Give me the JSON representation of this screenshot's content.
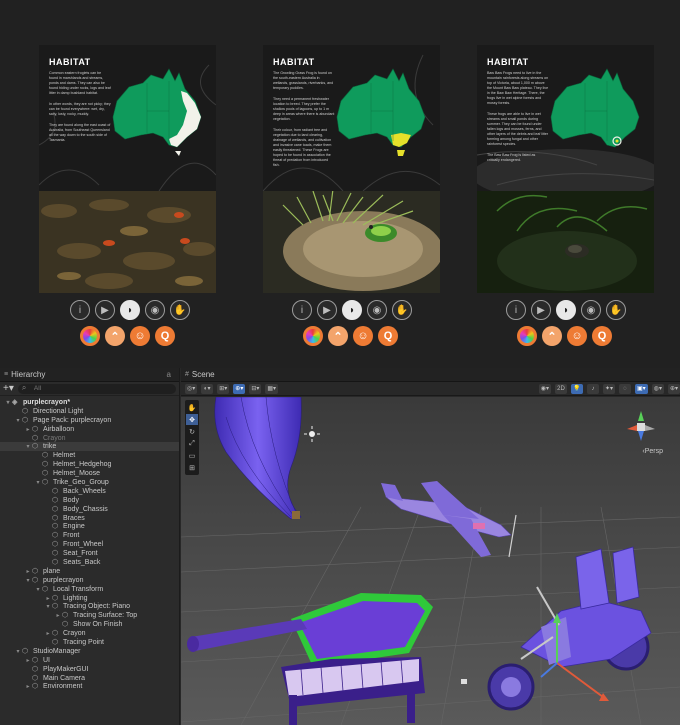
{
  "gallery": {
    "cards": [
      {
        "title": "HABITAT",
        "paragraphs": [
          "Common eastern froglets can be found in marshlands and streams, ponds and dams. They can also be found hiding under rocks, logs and leaf litter in damp bushland habitat.",
          "In other words, they are not picky; they can be found everywhere: wet, dry, salty, lusty, rocky, muddy.",
          "They are found along the east coast of Australia, from Southeast Queensland all the way down to the south side of Tasmania."
        ]
      },
      {
        "title": "HABITAT",
        "paragraphs": [
          "The Growling Grass Frog is found on the south-eastern Australia in wetlands, grasslands, riverbanks, and temporary puddles.",
          "They need a permanent freshwater location to breed. They prefer the shallow pools of lagoons, up to 1 m deep in areas where there is abundant vegetation.",
          "Their colour, from radiant tree and vegetation due to land clearing, drainage of wetlands, and cultivation and invasive cane toads, make them easily threatened. These Frogs are hoped to be found in association the threat of predation from introduced fish."
        ]
      },
      {
        "title": "HABITAT",
        "paragraphs": [
          "Baw Baw Frogs need to live in the mountain rainforests along streams on top of Victoria, about 1,000 m above the Mount Baw Baw plateau. They live in the Baw Baw Heritage. There, the frogs live in wet alpine forests and mossy forests.",
          "These frogs are able to live in wet streams and small ponds during summer. They can be found under fallen logs and mosses, ferns, and other layers of the debris and leaf litter forming among fungal and other rainforest species.",
          "The Baw Baw Frog is listed as critically endangered."
        ]
      }
    ],
    "controls": {
      "row1_icons": [
        "info-icon",
        "video-icon",
        "australia-map-icon",
        "frog-face-icon",
        "hand-icon"
      ],
      "row1_glyphs": [
        "i",
        "▶",
        "◗",
        "◉",
        "✋"
      ],
      "active_index": 2,
      "row2_icons": [
        "color-wheel-icon",
        "chevron-up-icon",
        "face-icon",
        "quiz-icon"
      ],
      "row2_glyphs": [
        "",
        "⌃",
        "☺",
        "Q"
      ]
    }
  },
  "hierarchy": {
    "tab_label": "Hierarchy",
    "tab_lock": "a",
    "search_placeholder": "All",
    "rows": [
      {
        "indent": 0,
        "arrow": "▾",
        "label": "purplecrayon*",
        "root": true
      },
      {
        "indent": 1,
        "arrow": "",
        "label": "Directional Light"
      },
      {
        "indent": 1,
        "arrow": "▾",
        "label": "Page Pack: purplecrayon"
      },
      {
        "indent": 2,
        "arrow": "▸",
        "label": "Airballoon"
      },
      {
        "indent": 2,
        "arrow": "",
        "label": "Crayon",
        "dim": true
      },
      {
        "indent": 2,
        "arrow": "▾",
        "label": "trike",
        "selected": true
      },
      {
        "indent": 3,
        "arrow": "",
        "label": "Helmet"
      },
      {
        "indent": 3,
        "arrow": "",
        "label": "Helmet_Hedgehog"
      },
      {
        "indent": 3,
        "arrow": "",
        "label": "Helmet_Moose"
      },
      {
        "indent": 3,
        "arrow": "▾",
        "label": "Trike_Geo_Group"
      },
      {
        "indent": 4,
        "arrow": "",
        "label": "Back_Wheels"
      },
      {
        "indent": 4,
        "arrow": "",
        "label": "Body"
      },
      {
        "indent": 4,
        "arrow": "",
        "label": "Body_Chassis"
      },
      {
        "indent": 4,
        "arrow": "",
        "label": "Braces"
      },
      {
        "indent": 4,
        "arrow": "",
        "label": "Engine"
      },
      {
        "indent": 4,
        "arrow": "",
        "label": "Front"
      },
      {
        "indent": 4,
        "arrow": "",
        "label": "Front_Wheel"
      },
      {
        "indent": 4,
        "arrow": "",
        "label": "Seat_Front"
      },
      {
        "indent": 4,
        "arrow": "",
        "label": "Seats_Back"
      },
      {
        "indent": 2,
        "arrow": "▸",
        "label": "plane"
      },
      {
        "indent": 2,
        "arrow": "▾",
        "label": "purplecrayon"
      },
      {
        "indent": 3,
        "arrow": "▾",
        "label": "Local Transform"
      },
      {
        "indent": 4,
        "arrow": "▸",
        "label": "Lighting"
      },
      {
        "indent": 4,
        "arrow": "▾",
        "label": "Tracing Object: Piano"
      },
      {
        "indent": 5,
        "arrow": "▸",
        "label": "Tracing Surface: Top"
      },
      {
        "indent": 5,
        "arrow": "",
        "label": "Show On Finish"
      },
      {
        "indent": 4,
        "arrow": "▸",
        "label": "Crayon"
      },
      {
        "indent": 4,
        "arrow": "",
        "label": "Tracing Point"
      },
      {
        "indent": 1,
        "arrow": "▾",
        "label": "StudioManager"
      },
      {
        "indent": 2,
        "arrow": "▸",
        "label": "UI"
      },
      {
        "indent": 2,
        "arrow": "",
        "label": "PlayMakerGUI"
      },
      {
        "indent": 2,
        "arrow": "",
        "label": "Main Camera"
      },
      {
        "indent": 2,
        "arrow": "▸",
        "label": "Environment"
      }
    ]
  },
  "scene": {
    "tab_label": "Scene",
    "view_mode": "2D",
    "camera_label": "Persp"
  },
  "colors": {
    "accent_orange": "#ee7b34",
    "map_green": "#0f9b5c",
    "purple_model": "#6b52e0",
    "selection_blue": "#3d6bb3"
  }
}
